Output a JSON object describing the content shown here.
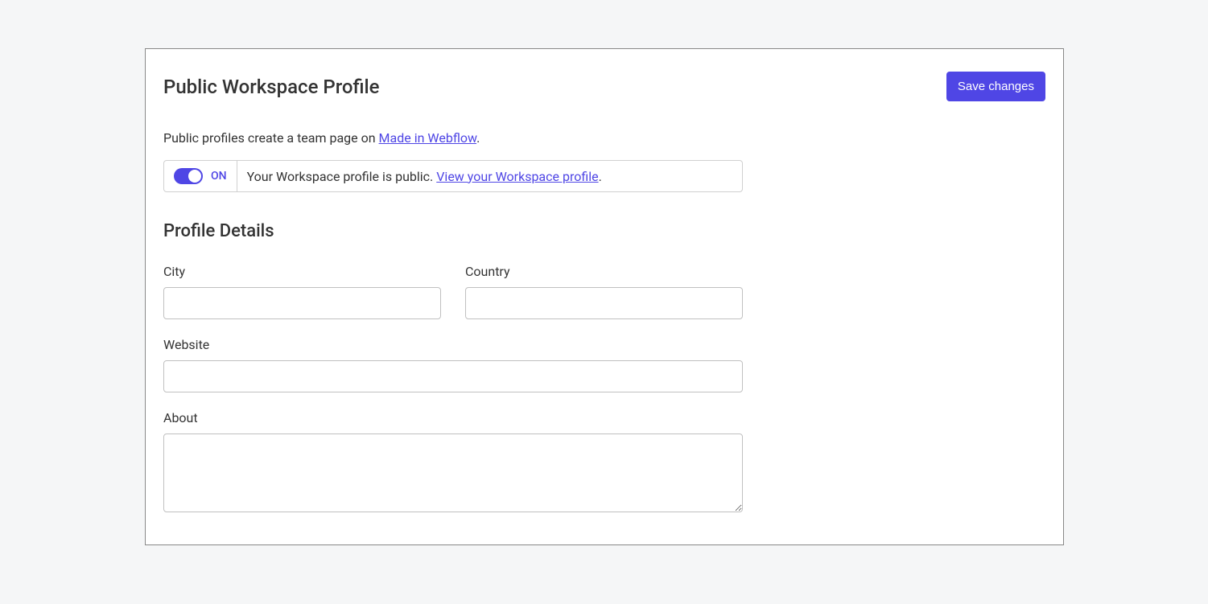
{
  "header": {
    "title": "Public Workspace Profile",
    "save_label": "Save changes"
  },
  "intro": {
    "prefix": "Public profiles create a team page on ",
    "link_text": "Made in Webflow",
    "suffix": "."
  },
  "toggle": {
    "state_label": "ON",
    "status_text": "Your Workspace profile is public. ",
    "view_link": "View your Workspace profile",
    "suffix": "."
  },
  "section": {
    "title": "Profile Details"
  },
  "fields": {
    "city": {
      "label": "City",
      "value": ""
    },
    "country": {
      "label": "Country",
      "value": ""
    },
    "website": {
      "label": "Website",
      "value": ""
    },
    "about": {
      "label": "About",
      "value": ""
    }
  }
}
